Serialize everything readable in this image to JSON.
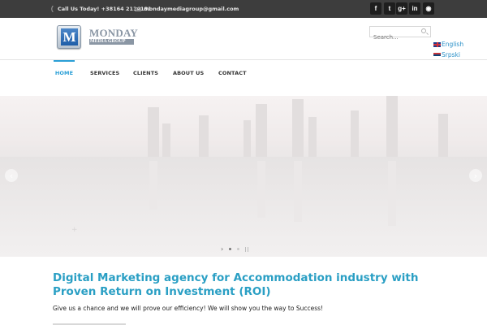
{
  "topbar": {
    "phone_icon": "phone-icon",
    "phone_text": "Call Us Today! +38164 2114181",
    "email_icon": "mail-icon",
    "email_text": "mondaymediagroup@gmail.com",
    "social": [
      {
        "icon": "facebook-icon",
        "glyph": "f"
      },
      {
        "icon": "twitter-icon",
        "glyph": "t"
      },
      {
        "icon": "google-plus-icon",
        "glyph": "g+"
      },
      {
        "icon": "linkedin-icon",
        "glyph": "in"
      },
      {
        "icon": "rss-icon",
        "glyph": "◉"
      }
    ]
  },
  "header": {
    "logo_letter": "M",
    "logo_name": "MONDAY",
    "logo_sub": "MEDIA GROUP",
    "search_placeholder": "Search...",
    "languages": [
      {
        "label": "English",
        "flag": "uk-flag-icon"
      },
      {
        "label": "Srpski",
        "flag": "serbia-flag-icon"
      }
    ]
  },
  "nav": {
    "items": [
      {
        "label": "HOME",
        "active": true
      },
      {
        "label": "SERVICES",
        "active": false
      },
      {
        "label": "CLIENTS",
        "active": false
      },
      {
        "label": "ABOUT US",
        "active": false
      },
      {
        "label": "CONTACT",
        "active": false
      }
    ]
  },
  "slider": {
    "prev_glyph": "‹",
    "next_glyph": "›",
    "control_next_glyph": "›",
    "slide_count": 2,
    "active_slide": 1
  },
  "content": {
    "headline": "Digital Marketing agency for Accommodation industry with Proven Return on Investment (ROI)",
    "subline": "Give us a chance and we will prove our efficiency! We will show you the way to Success!"
  },
  "colors": {
    "accent": "#2a9fd6",
    "topbar_bg": "#3d3d3d",
    "headline": "#2a9fc4"
  }
}
